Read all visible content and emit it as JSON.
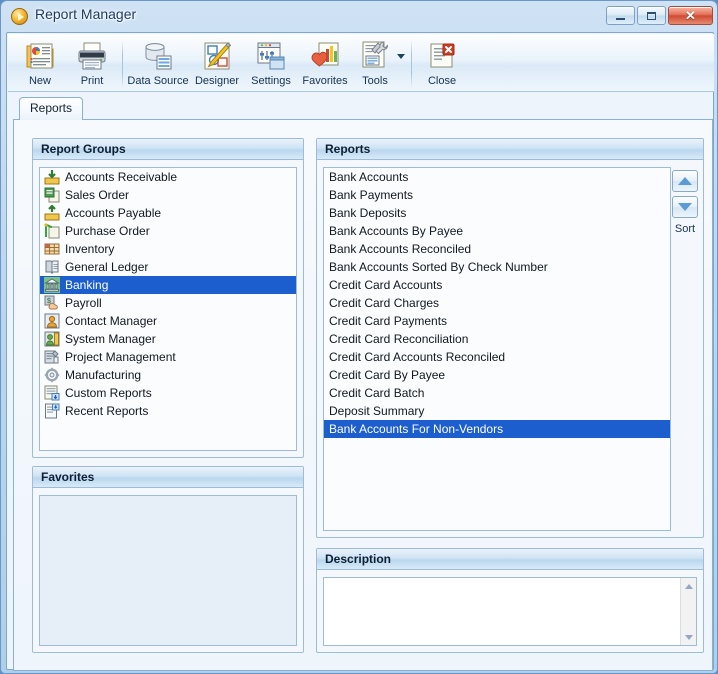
{
  "window": {
    "title": "Report Manager",
    "app_icon": "play-circle-icon",
    "minimize_label": "Minimize",
    "maximize_label": "Maximize",
    "close_label": "Close"
  },
  "toolbar": {
    "items": [
      {
        "label": "New",
        "icon": "new-report-icon"
      },
      {
        "label": "Print",
        "icon": "printer-icon"
      },
      {
        "label": "Data Source",
        "icon": "database-icon"
      },
      {
        "label": "Designer",
        "icon": "designer-pencil-icon"
      },
      {
        "label": "Settings",
        "icon": "settings-window-icon"
      },
      {
        "label": "Favorites",
        "icon": "favorites-hand-chart-icon"
      },
      {
        "label": "Tools",
        "icon": "tools-wrench-icon"
      },
      {
        "label": "Close",
        "icon": "close-document-icon"
      }
    ],
    "tools_dropdown_icon": "chevron-down-icon"
  },
  "tabs": [
    {
      "label": "Reports",
      "active": true
    }
  ],
  "report_groups": {
    "title": "Report Groups",
    "items": [
      {
        "label": "Accounts Receivable",
        "icon": "accounts-receivable-icon",
        "selected": false
      },
      {
        "label": "Sales Order",
        "icon": "sales-order-icon",
        "selected": false
      },
      {
        "label": "Accounts Payable",
        "icon": "accounts-payable-icon",
        "selected": false
      },
      {
        "label": "Purchase Order",
        "icon": "purchase-order-icon",
        "selected": false
      },
      {
        "label": "Inventory",
        "icon": "inventory-icon",
        "selected": false
      },
      {
        "label": "General Ledger",
        "icon": "general-ledger-icon",
        "selected": false
      },
      {
        "label": "Banking",
        "icon": "banking-icon",
        "selected": true
      },
      {
        "label": "Payroll",
        "icon": "payroll-icon",
        "selected": false
      },
      {
        "label": "Contact Manager",
        "icon": "contact-manager-icon",
        "selected": false
      },
      {
        "label": "System Manager",
        "icon": "system-manager-icon",
        "selected": false
      },
      {
        "label": "Project Management",
        "icon": "project-management-icon",
        "selected": false
      },
      {
        "label": "Manufacturing",
        "icon": "manufacturing-icon",
        "selected": false
      },
      {
        "label": "Custom Reports",
        "icon": "custom-reports-icon",
        "selected": false
      },
      {
        "label": "Recent Reports",
        "icon": "recent-reports-icon",
        "selected": false
      }
    ]
  },
  "favorites": {
    "title": "Favorites",
    "items": []
  },
  "reports": {
    "title": "Reports",
    "items": [
      {
        "label": "Bank Accounts",
        "selected": false
      },
      {
        "label": "Bank Payments",
        "selected": false
      },
      {
        "label": "Bank Deposits",
        "selected": false
      },
      {
        "label": "Bank Accounts By Payee",
        "selected": false
      },
      {
        "label": "Bank Accounts Reconciled",
        "selected": false
      },
      {
        "label": "Bank Accounts Sorted By Check Number",
        "selected": false
      },
      {
        "label": "Credit Card Accounts",
        "selected": false
      },
      {
        "label": "Credit Card Charges",
        "selected": false
      },
      {
        "label": "Credit Card Payments",
        "selected": false
      },
      {
        "label": "Credit Card Reconciliation",
        "selected": false
      },
      {
        "label": "Credit Card Accounts Reconciled",
        "selected": false
      },
      {
        "label": "Credit Card By Payee",
        "selected": false
      },
      {
        "label": "Credit Card Batch",
        "selected": false
      },
      {
        "label": "Deposit Summary",
        "selected": false
      },
      {
        "label": "Bank Accounts For Non-Vendors",
        "selected": true
      }
    ]
  },
  "sort": {
    "label": "Sort",
    "up_icon": "sort-up-arrow-icon",
    "down_icon": "sort-down-arrow-icon"
  },
  "description": {
    "title": "Description",
    "text": "",
    "scroll_up_icon": "scroll-up-arrow-icon",
    "scroll_down_icon": "scroll-down-arrow-icon"
  },
  "colors": {
    "selection_blue": "#1c5ecd",
    "title_text": "#1d3c63",
    "panel_header_gradient_top": "#eaf3fb",
    "panel_header_gradient_bottom": "#d9eaf8",
    "window_frame": "#aecfea",
    "close_button_red": "#cf4a31",
    "sort_arrow_blue": "#5b9bd5"
  }
}
